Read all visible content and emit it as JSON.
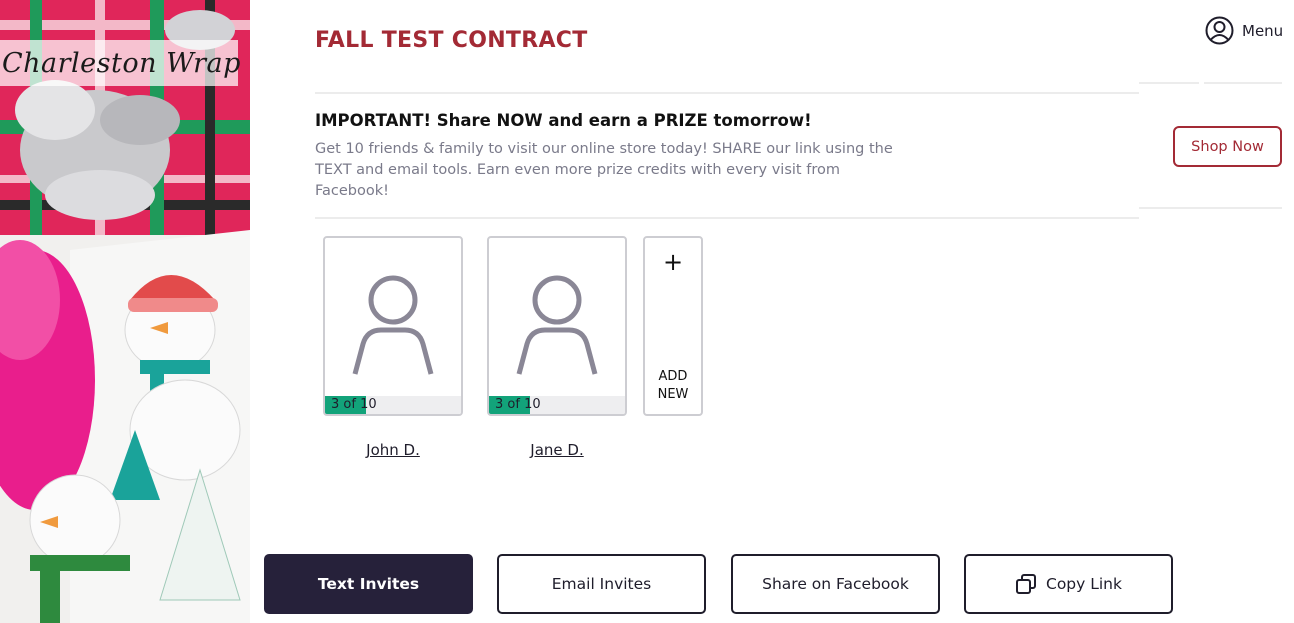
{
  "brand": {
    "logo_text": "Charleston Wrap"
  },
  "header": {
    "title": "FALL TEST CONTRACT",
    "menu_label": "Menu"
  },
  "banner": {
    "title": "IMPORTANT! Share NOW and earn a PRIZE tomorrow!",
    "text": "Get 10 friends & family to visit our online store today! SHARE our link using the TEXT and email tools. Earn even more prize credits with every visit from Facebook!",
    "shop_label": "Shop Now"
  },
  "members": [
    {
      "name": "John D.",
      "progress_label": "3 of 10",
      "progress": 0.3
    },
    {
      "name": "Jane D.",
      "progress_label": "3 of 10",
      "progress": 0.3
    }
  ],
  "add_new": {
    "plus": "+",
    "label": "ADD NEW"
  },
  "actions": {
    "text_invites": "Text Invites",
    "email_invites": "Email Invites",
    "share_facebook": "Share on Facebook",
    "copy_link": "Copy Link"
  },
  "colors": {
    "accent": "#a32a35",
    "progress": "#12a37a",
    "primary_button": "#26213a"
  }
}
